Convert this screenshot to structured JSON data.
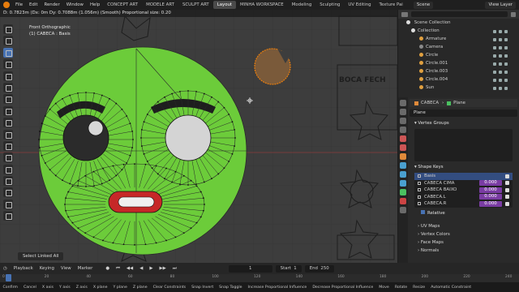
{
  "menubar": {
    "menus": [
      "File",
      "Edit",
      "Render",
      "Window",
      "Help"
    ],
    "workspaces": [
      "CONCEPT ART",
      "MODELE ART",
      "SCULPT ART",
      "Layout",
      "MINHA WORKSPACE",
      "Modeling",
      "Sculpting",
      "UV Editing",
      "Texture Pai"
    ],
    "active_workspace": "Layout",
    "scene": "Scene",
    "view_layer": "View Layer"
  },
  "viewport": {
    "header_status": "D: 0.7823m  (Dx: 0m  Dy: 0.7088m (1.056m) (Smooth)   Proportional size: 0.20",
    "view_name": "Front Orthographic",
    "object_info": "(1) CABECA : Basis",
    "select_linked": "Select Linked All",
    "sign_text": "BOCA FECH"
  },
  "outliner": {
    "title": "Scene Collection",
    "items": [
      {
        "label": "Collection",
        "color": "#dddddd",
        "indent": 1
      },
      {
        "label": "Armature",
        "color": "#e0a040",
        "indent": 2
      },
      {
        "label": "Camera",
        "color": "#8a8a8a",
        "indent": 2
      },
      {
        "label": "Circle",
        "color": "#e0a040",
        "indent": 2
      },
      {
        "label": "Circle.001",
        "color": "#e0a040",
        "indent": 2
      },
      {
        "label": "Circle.003",
        "color": "#e0a040",
        "indent": 2
      },
      {
        "label": "Circle.004",
        "color": "#e0a040",
        "indent": 2
      },
      {
        "label": "Sun",
        "color": "#e0a040",
        "indent": 2
      }
    ]
  },
  "properties": {
    "object_name": "CABECA",
    "data_name": "Plane",
    "search_value": "Plane",
    "vertex_groups_label": "Vertex Groups",
    "shape_keys_label": "Shape Keys",
    "shape_keys": [
      {
        "name": "Basis",
        "value": ""
      },
      {
        "name": "CABECA CIMA",
        "value": "0.000"
      },
      {
        "name": "CABECA BAIXO",
        "value": "0.000"
      },
      {
        "name": "CABECA.L",
        "value": "0.000"
      },
      {
        "name": "CABECA.R",
        "value": "0.000"
      }
    ],
    "relative_label": "Relative",
    "sub_panels": [
      "UV Maps",
      "Vertex Colors",
      "Face Maps",
      "Normals"
    ]
  },
  "timeline": {
    "playback": "Playback",
    "keying": "Keying",
    "view": "View",
    "marker": "Marker",
    "current_frame": "1",
    "start_label": "Start",
    "start_value": "1",
    "end_label": "End",
    "end_value": "250",
    "ticks": [
      "0",
      "20",
      "40",
      "60",
      "80",
      "100",
      "120",
      "140",
      "160",
      "180",
      "200",
      "220",
      "240"
    ]
  },
  "statusbar": {
    "items": [
      "Confirm",
      "Cancel",
      "X axis",
      "Y axis",
      "Z axis",
      "X plane",
      "Y plane",
      "Z plane",
      "Clear Constraints",
      "Snap Invert",
      "Snap Toggle",
      "Increase Proportional Influence",
      "Decrease Proportional Influence",
      "Move",
      "Rotate",
      "Resize",
      "Automatic Constraint"
    ]
  },
  "colors": {
    "accent": "#4772b3",
    "face_green": "#6ccc3a",
    "selection": "#e87d0d",
    "shape_value": "#7a3ca3"
  }
}
